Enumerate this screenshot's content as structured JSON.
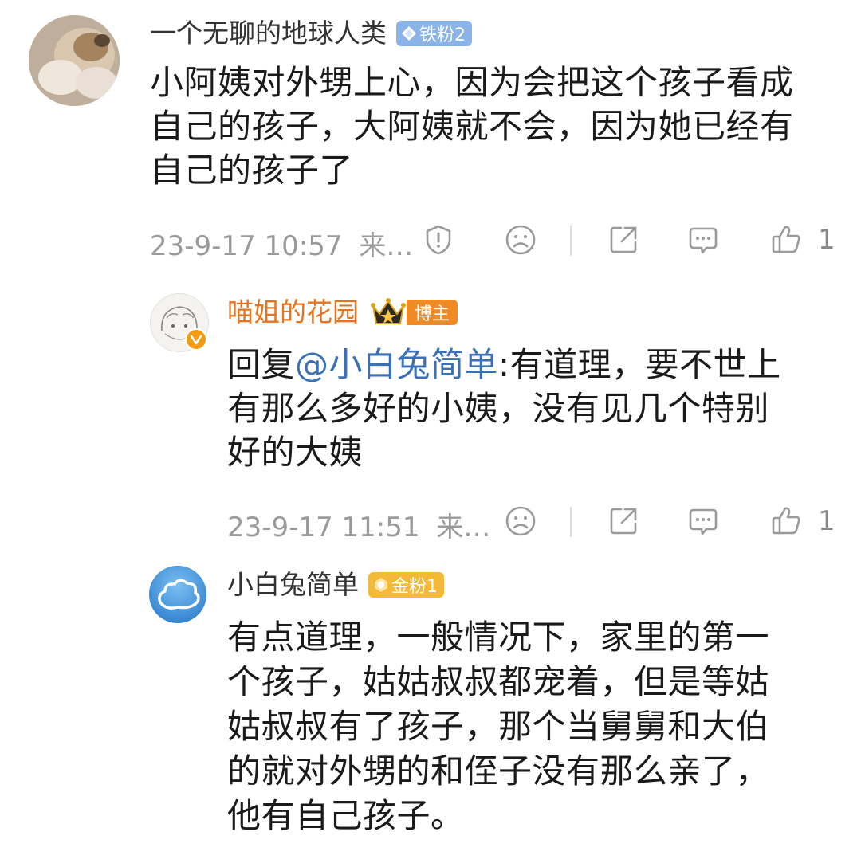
{
  "comments": [
    {
      "username": "一个无聊的地球人类",
      "badge": "铁粉2",
      "content": "小阿姨对外甥上心，因为会把这个孩子看成自己的孩子，大阿姨就不会，因为她已经有自己的孩子了",
      "content_lines": [
        "小阿姨对外甥上心，因为会把这个孩子看成",
        "自己的孩子，大阿姨就不会，因为她已经有",
        "自己的孩子了"
      ],
      "timestamp": "23-9-17 10:57",
      "source": "来…",
      "like_count": "1"
    },
    {
      "username": "喵姐的花园",
      "badge": "博主",
      "reply_prefix": "回复",
      "mention": "@小白兔简单",
      "content_lines": [
        ":有道理，要不世上",
        "有那么多好的小姨，没有见几个特别",
        "好的大姨"
      ],
      "timestamp": "23-9-17 11:51",
      "source": "来…",
      "like_count": "1"
    },
    {
      "username": "小白兔简单",
      "badge": "金粉1",
      "content_lines": [
        "有点道理，一般情况下，家里的第一",
        "个孩子，姑姑叔叔都宠着，但是等姑",
        "姑叔叔有了孩子，那个当舅舅和大伯",
        "的就对外甥的和侄子没有那么亲了，",
        "他有自己孩子。"
      ]
    }
  ],
  "colors": {
    "blogger_name": "#e8731a",
    "iron_fan_badge": "#8ab4e8",
    "blogger_badge": "#f08a24",
    "gold_fan_badge": "#f5b93a",
    "mention": "#3b6fb6",
    "meta_text": "#9a9a9a"
  },
  "icons": [
    "report-icon",
    "dislike-icon",
    "share-icon",
    "comment-icon",
    "like-icon"
  ]
}
